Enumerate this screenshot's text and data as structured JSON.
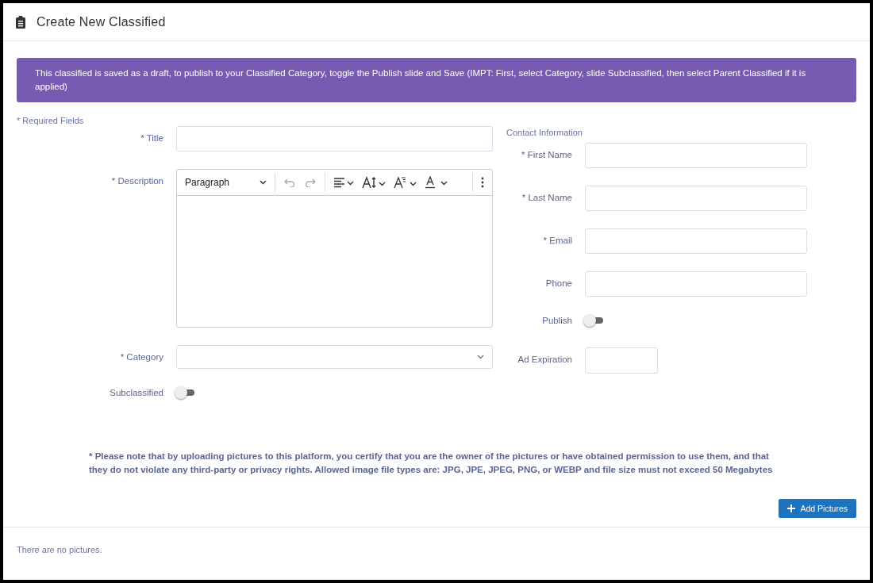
{
  "header": {
    "title": "Create New Classified"
  },
  "banner": {
    "text": "This classified is saved as a draft, to publish to your Classified Category, toggle the Publish slide and Save (IMPT: First, select Category, slide Subclassified, then select Parent Classified if it is applied)"
  },
  "required_note": "* Required Fields",
  "left_fields": [
    {
      "kind": "text",
      "label": "* Title"
    },
    {
      "kind": "editor",
      "label": "* Description",
      "block_format": "Paragraph"
    },
    {
      "kind": "select",
      "label": "* Category"
    },
    {
      "kind": "toggle",
      "label": "Subclassified",
      "on": false
    }
  ],
  "contact": {
    "title": "Contact Information",
    "fields": [
      {
        "kind": "text",
        "label": "* First Name"
      },
      {
        "kind": "text",
        "label": "* Last Name"
      },
      {
        "kind": "text",
        "label": "* Email"
      },
      {
        "kind": "text",
        "label": "Phone"
      },
      {
        "kind": "toggle",
        "label": "Publish",
        "on": false
      },
      {
        "kind": "short",
        "label": "Ad Expiration"
      }
    ]
  },
  "notice": "* Please note that by uploading pictures to this platform, you certify that you are the owner of the pictures or have obtained permission to use them, and that they do not violate any third-party or privacy rights. Allowed image file types are: JPG, JPE, JPEG, PNG, or WEBP and file size must not exceed 50 Megabytes",
  "add_button": {
    "label": "Add Pictures"
  },
  "empty_message": "There are no pictures."
}
